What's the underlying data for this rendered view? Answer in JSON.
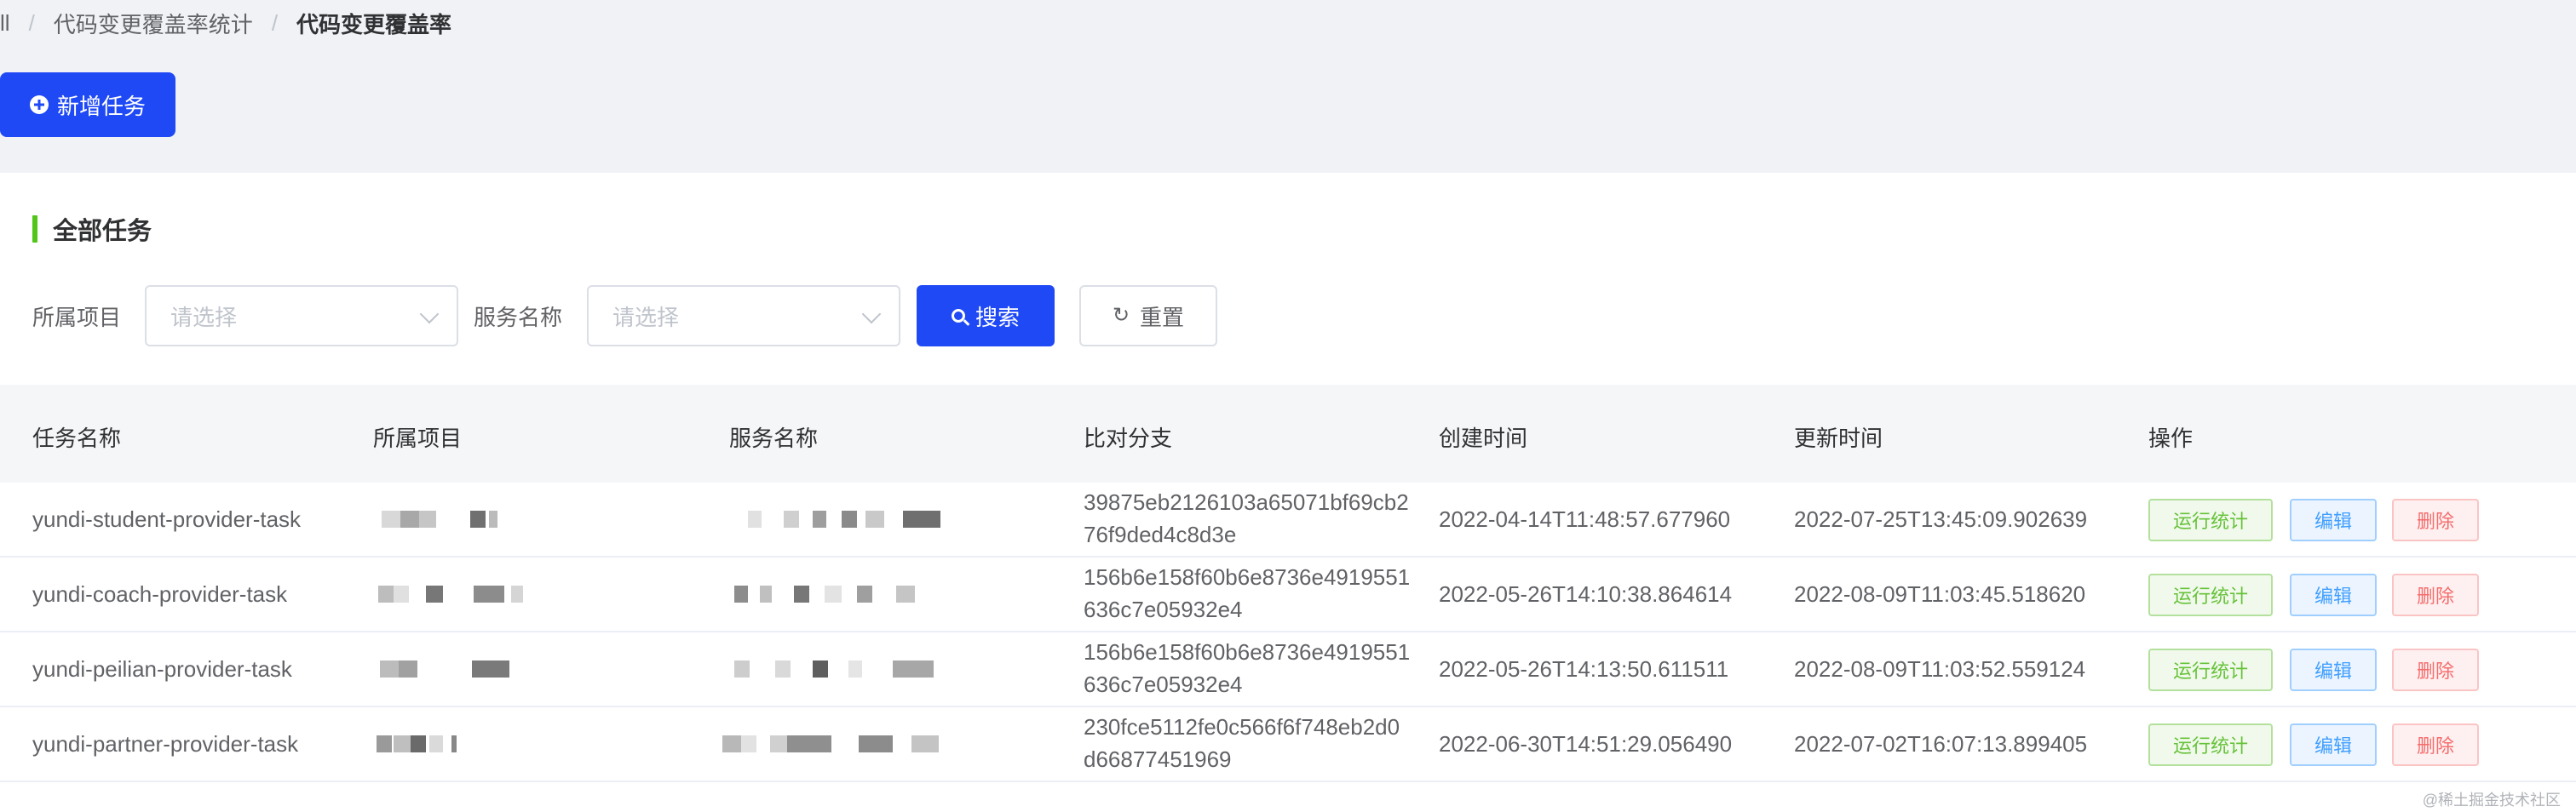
{
  "breadcrumb": {
    "root": "ll",
    "parent": "代码变更覆盖率统计",
    "current": "代码变更覆盖率"
  },
  "toolbar": {
    "new_task_label": "新增任务"
  },
  "section": {
    "title": "全部任务"
  },
  "filters": {
    "project_label": "所属项目",
    "project_placeholder": "请选择",
    "service_label": "服务名称",
    "service_placeholder": "请选择",
    "search_label": "搜索",
    "reset_label": "重置"
  },
  "table": {
    "columns": [
      "任务名称",
      "所属项目",
      "服务名称",
      "比对分支",
      "创建时间",
      "更新时间",
      "操作"
    ],
    "rows": [
      {
        "task_name": "yundi-student-provider-task",
        "branch_line1": "39875eb2126103a65071bf69cb2",
        "branch_line2": "76f9ded4c8d3e",
        "created": "2022-04-14T11:48:57.677960",
        "updated": "2022-07-25T13:45:09.902639"
      },
      {
        "task_name": "yundi-coach-provider-task",
        "branch_line1": "156b6e158f60b6e8736e4919551",
        "branch_line2": "636c7e05932e4",
        "created": "2022-05-26T14:10:38.864614",
        "updated": "2022-08-09T11:03:45.518620"
      },
      {
        "task_name": "yundi-peilian-provider-task",
        "branch_line1": "156b6e158f60b6e8736e4919551",
        "branch_line2": "636c7e05932e4",
        "created": "2022-05-26T14:13:50.611511",
        "updated": "2022-08-09T11:03:52.559124"
      },
      {
        "task_name": "yundi-partner-provider-task",
        "branch_line1": "230fce5112fe0c566f6f748eb2d0",
        "branch_line2": "d66877451969",
        "created": "2022-06-30T14:51:29.056490",
        "updated": "2022-07-02T16:07:13.899405"
      }
    ],
    "actions": {
      "run_stats": "运行统计",
      "edit": "编辑",
      "delete": "删除"
    }
  },
  "watermark": "@稀土掘金技术社区",
  "colors": {
    "primary": "#1e49f5",
    "title_accent": "#52c41a",
    "success": "#67c23a",
    "info": "#409eff",
    "danger": "#f56c6c"
  }
}
